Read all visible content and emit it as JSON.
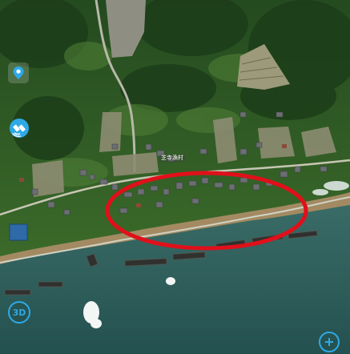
{
  "map": {
    "view": "satellite",
    "village_label": "芝寺漁村",
    "highlight_color": "#e0101a"
  },
  "controls": {
    "location_icon": "location-pin-icon",
    "satellite_icon": "satellite-icon",
    "threed_label": "3D",
    "zoom_in_icon": "plus-icon",
    "accent_color": "#2ea9e6"
  }
}
